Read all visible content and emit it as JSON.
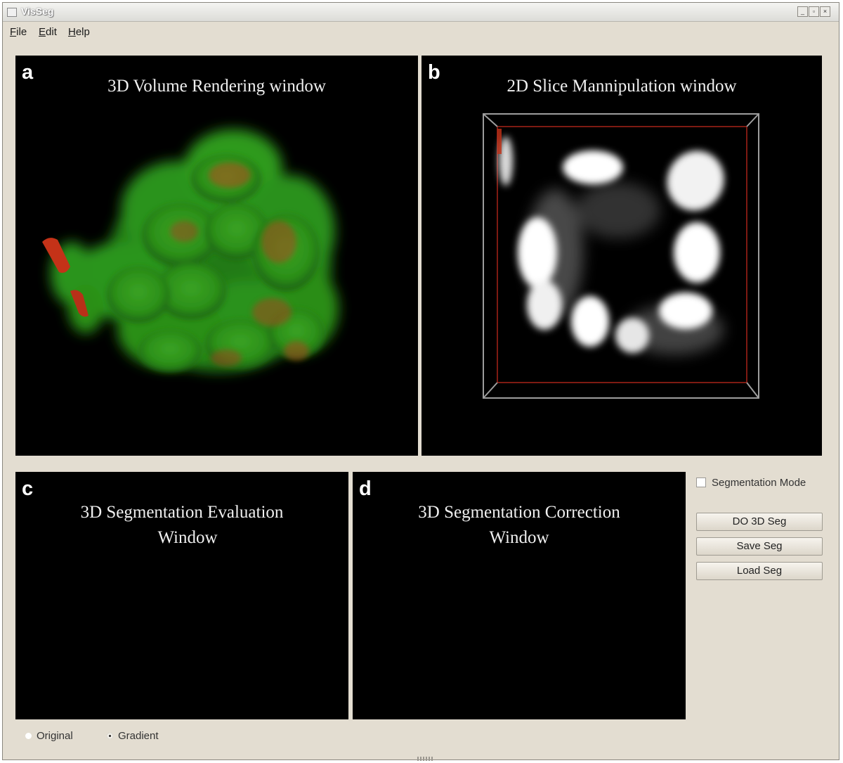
{
  "window": {
    "title": "VisSeg"
  },
  "menu": [
    "File",
    "Edit",
    "Help"
  ],
  "panes": {
    "a": {
      "letter": "a",
      "title": "3D Volume Rendering window"
    },
    "b": {
      "letter": "b",
      "title": "2D Slice Mannipulation window"
    },
    "c": {
      "letter": "c",
      "title_line1": "3D Segmentation Evaluation",
      "title_line2": "Window"
    },
    "d": {
      "letter": "d",
      "title_line1": "3D Segmentation Correction",
      "title_line2": "Window"
    }
  },
  "controls": {
    "segmentation_mode_label": "Segmentation Mode",
    "segmentation_mode_checked": false,
    "buttons": [
      "DO 3D Seg",
      "Save Seg",
      "Load Seg"
    ]
  },
  "view_mode": {
    "options": [
      "Original",
      "Gradient"
    ],
    "selected": "Gradient"
  },
  "colors": {
    "window_bg": "#e3ddd1",
    "viewport_bg": "#000000",
    "volume_green": "#2f9a1c",
    "volume_red": "#c43218",
    "slice_white": "#ffffff",
    "bbox_red": "#8a1a12"
  }
}
